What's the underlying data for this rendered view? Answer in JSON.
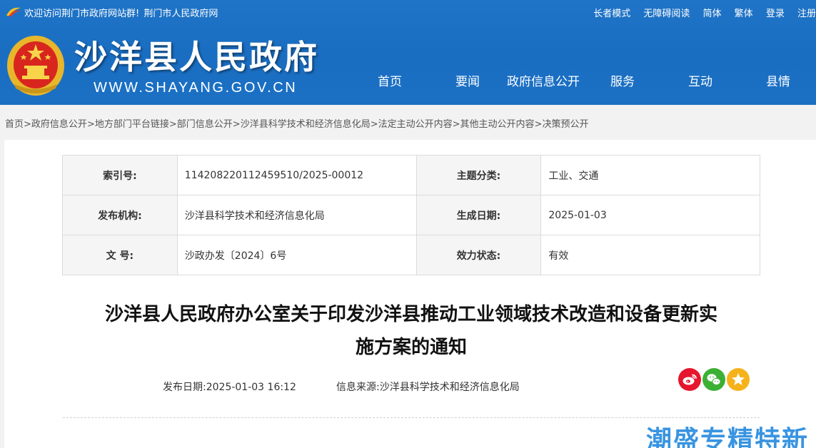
{
  "topbar": {
    "welcome": "欢迎访问荆门市政府网站群!",
    "portal": "荆门市人民政府网",
    "links": [
      "长者模式",
      "无障碍阅读",
      "简体",
      "繁体",
      "登录",
      "注册"
    ]
  },
  "site": {
    "name": "沙洋县人民政府",
    "url": "WWW.SHAYANG.GOV.CN"
  },
  "nav": [
    "首页",
    "要闻",
    "政府信息公开",
    "服务",
    "互动",
    "县情"
  ],
  "breadcrumb": [
    "首页",
    "政府信息公开",
    "地方部门平台链接",
    "部门信息公开",
    "沙洋县科学技术和经济信息化局",
    "法定主动公开内容",
    "其他主动公开内容",
    "决策预公开"
  ],
  "meta": {
    "index_label": "索引号:",
    "index_value": "114208220112459510/2025-00012",
    "topic_label": "主题分类:",
    "topic_value": "工业、交通",
    "org_label": "发布机构:",
    "org_value": "沙洋县科学技术和经济信息化局",
    "date_label": "生成日期:",
    "date_value": "2025-01-03",
    "docno_label": "文 号:",
    "docno_value": "沙政办发〔2024〕6号",
    "status_label": "效力状态:",
    "status_value": "有效"
  },
  "article": {
    "title_line1": "沙洋县人民政府办公室关于印发沙洋县推动工业领域技术改造和设备更新实",
    "title_line2": "施方案的通知",
    "pub_date_label": "发布日期:",
    "pub_date": "2025-01-03 16:12",
    "source_label": "信息来源:",
    "source": "沙洋县科学技术和经济信息化局"
  },
  "share": {
    "weibo_icon": "weibo-icon",
    "wechat_icon": "wechat-icon",
    "favorite_icon": "star-icon",
    "colors": {
      "weibo": "#e6162d",
      "wechat": "#3cb034",
      "favorite": "#f5b21b"
    }
  },
  "watermark": "潮盛专精特新",
  "colors": {
    "header": "#1b70c4",
    "link_text": "#ffffff"
  }
}
